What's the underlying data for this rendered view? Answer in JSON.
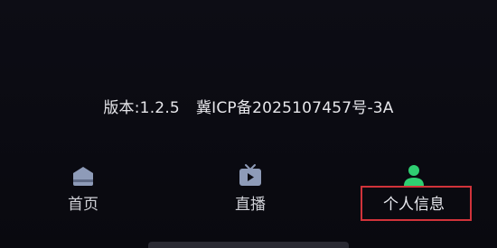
{
  "footer": {
    "version_text": "版本:1.2.5",
    "icp_text": "冀ICP备2025107457号-3A"
  },
  "tabbar": {
    "items": [
      {
        "label": "首页",
        "icon": "home-icon",
        "active": false
      },
      {
        "label": "直播",
        "icon": "tv-icon",
        "active": false
      },
      {
        "label": "个人信息",
        "icon": "person-icon",
        "active": true
      }
    ]
  },
  "colors": {
    "background": "#0b0b12",
    "inactive_icon": "#8e9bb8",
    "active_icon": "#2fcf72",
    "highlight_border": "#d1333a",
    "text": "#cfd0d6"
  }
}
